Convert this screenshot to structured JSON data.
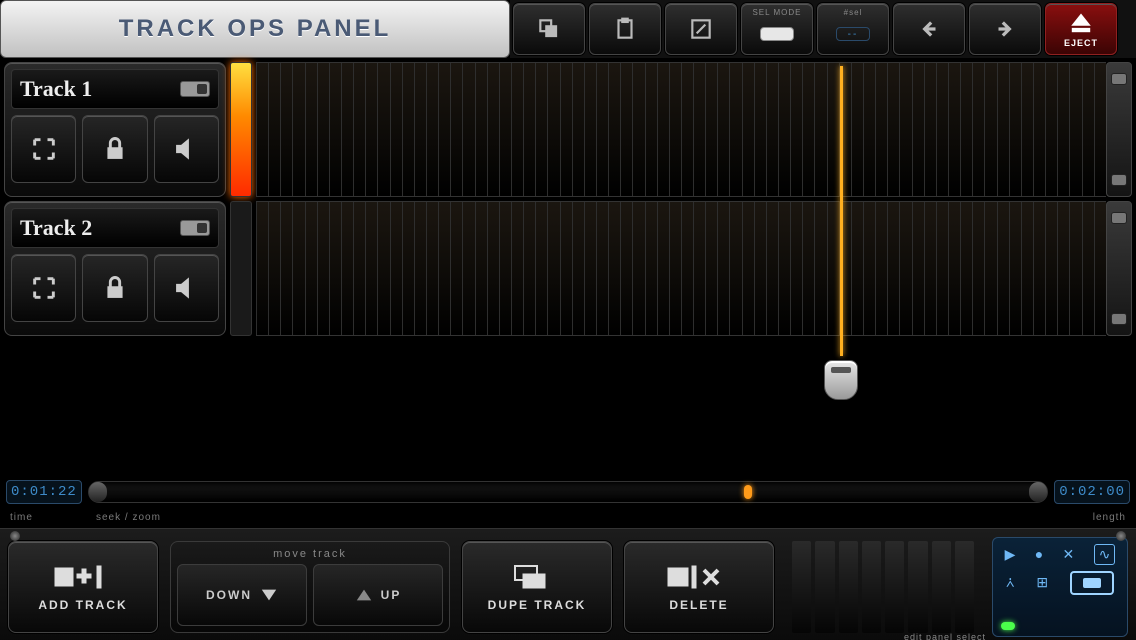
{
  "header": {
    "title": "TRACK OPS PANEL"
  },
  "toolbar": {
    "sel_mode_label": "SEL MODE",
    "sel_num_label": "#sel",
    "sel_num_value": "--",
    "eject_label": "EJECT"
  },
  "tracks": [
    {
      "name": "Track 1",
      "meter": "hot"
    },
    {
      "name": "Track 2",
      "meter": "cold"
    }
  ],
  "playhead": {
    "position_pct": 68.8
  },
  "seek": {
    "time_lcd": "0:01:22",
    "length_lcd": "0:02:00",
    "marker_pct": 68.8,
    "label_time": "time",
    "label_seekzoom": "seek / zoom",
    "label_length": "length"
  },
  "bottom": {
    "add_track": "ADD TRACK",
    "move_group": "move track",
    "down": "DOWN",
    "up": "UP",
    "dupe": "DUPE TRACK",
    "delete": "DELETE",
    "edit_panel_label": "edit panel select"
  }
}
